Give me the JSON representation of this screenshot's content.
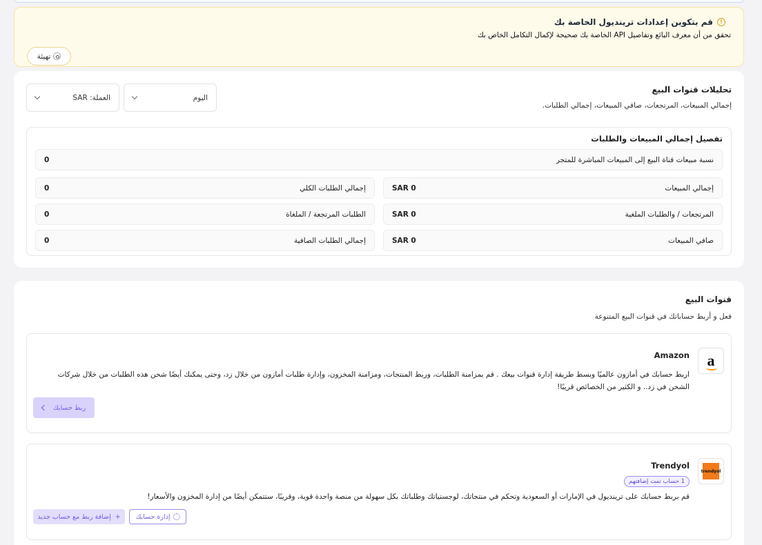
{
  "warning": {
    "title": "قم بتكوين إعدادات ترينديول الخاصة بك",
    "description": "تحقق من أن معرف البائع وتفاصيل API الخاصة بك صحيحة لإكمال التكامل الخاص بك",
    "setup_button": "تهيئة",
    "icon": "info-icon"
  },
  "analytics": {
    "title": "تحليلات قنوات البيع",
    "subtitle": "إجمالي المبيعات، المرتجعات، صافي المبيعات، إجمالي الطلبات.",
    "period_select": "اليوم",
    "currency_select": "العملة: SAR",
    "breakdown": {
      "title": "تفصيل إجمالي المبيعات والطلبات",
      "ratio_label": "نسبة مبيعات قناة البيع إلى المبيعات المباشرة للمتجر",
      "ratio_value": "0",
      "rows": [
        {
          "label": "إجمالي المبيعات",
          "value": "SAR 0"
        },
        {
          "label": "إجمالي الطلبات الكلي",
          "value": "0"
        },
        {
          "label": "المرتجعات / والطلبات الملغية",
          "value": "SAR 0"
        },
        {
          "label": "الطلبات المرتجعة / الملغاة",
          "value": "0"
        },
        {
          "label": "صافي المبيعات",
          "value": "SAR 0"
        },
        {
          "label": "إجمالي الطلبات الصافية",
          "value": "0"
        }
      ]
    }
  },
  "channels": {
    "title": "قنوات البيع",
    "subtitle": "فعل و أربط حساباتك في قنوات البيع المتنوعة",
    "amazon": {
      "name": "Amazon",
      "description": "اربط حسابك في أمازون عالميًا وبسط طريقة إدارة قنوات بيعك . قم بمزامنة الطلبات، وربط المنتجات، ومزامنة المخزون، وإدارة طلبات أمازون من خلال زد، وحتى يمكنك أيضًا شحن هذه الطلبات من خلال شركات الشحن في زد.. و الكثير من الخصائص قريبًا!",
      "link_button": "ربط حسابك"
    },
    "trendyol": {
      "name": "Trendyol",
      "logo_text": "trendyol",
      "badge": "1 حساب تمت إضافتهم",
      "description": "قم بربط حسابك على ترينديول في الإمارات أو السعودية وتحكم في منتجاتك، لوجستياتك وطلباتك بكل سهولة من منصة واحدة قوية، وقريبًا، ستتمكن أيضًا من إدارة المخزون والأسعار!",
      "manage_button": "إدارة حسابك",
      "add_button": "إضافة ربط مع حساب جديد"
    }
  }
}
